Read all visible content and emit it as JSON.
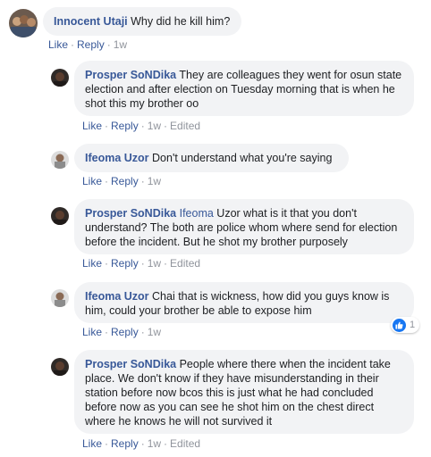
{
  "comments": [
    {
      "author": "Innocent Utaji",
      "text": " Why did he kill him?",
      "actions": {
        "like": "Like",
        "reply": "Reply",
        "time": "1w"
      }
    },
    {
      "author": "Prosper SoNDika",
      "text": " They are colleagues they went for osun state election and after election on Tuesday morning that is when he shot this my brother oo",
      "actions": {
        "like": "Like",
        "reply": "Reply",
        "time": "1w",
        "edited": "Edited"
      }
    },
    {
      "author": "Ifeoma Uzor",
      "text": " Don't understand what you're saying",
      "actions": {
        "like": "Like",
        "reply": "Reply",
        "time": "1w"
      }
    },
    {
      "author": "Prosper SoNDika",
      "mention": "Ifeoma",
      "text": " Uzor what is it that you don't understand? The both are police whom where send for election before the incident. But he shot my brother purposely",
      "actions": {
        "like": "Like",
        "reply": "Reply",
        "time": "1w",
        "edited": "Edited"
      }
    },
    {
      "author": "Ifeoma Uzor",
      "text": " Chai that is wickness, how did you guys know is him, could your brother be able to expose him",
      "actions": {
        "like": "Like",
        "reply": "Reply",
        "time": "1w"
      },
      "reaction": {
        "icon": "thumbs-up-icon",
        "count": "1"
      }
    },
    {
      "author": "Prosper SoNDika",
      "text": " People where there when the incident take place. We don't know if they have misunderstanding in their station before now bcos this is just what he had concluded before now as you can see he shot him on the chest direct where he knows he will not survived it",
      "actions": {
        "like": "Like",
        "reply": "Reply",
        "time": "1w",
        "edited": "Edited"
      }
    }
  ],
  "separator": "·",
  "colors": {
    "link": "#385898",
    "bubble": "#f2f3f5",
    "meta": "#90949c",
    "like_blue": "#1877f2"
  }
}
